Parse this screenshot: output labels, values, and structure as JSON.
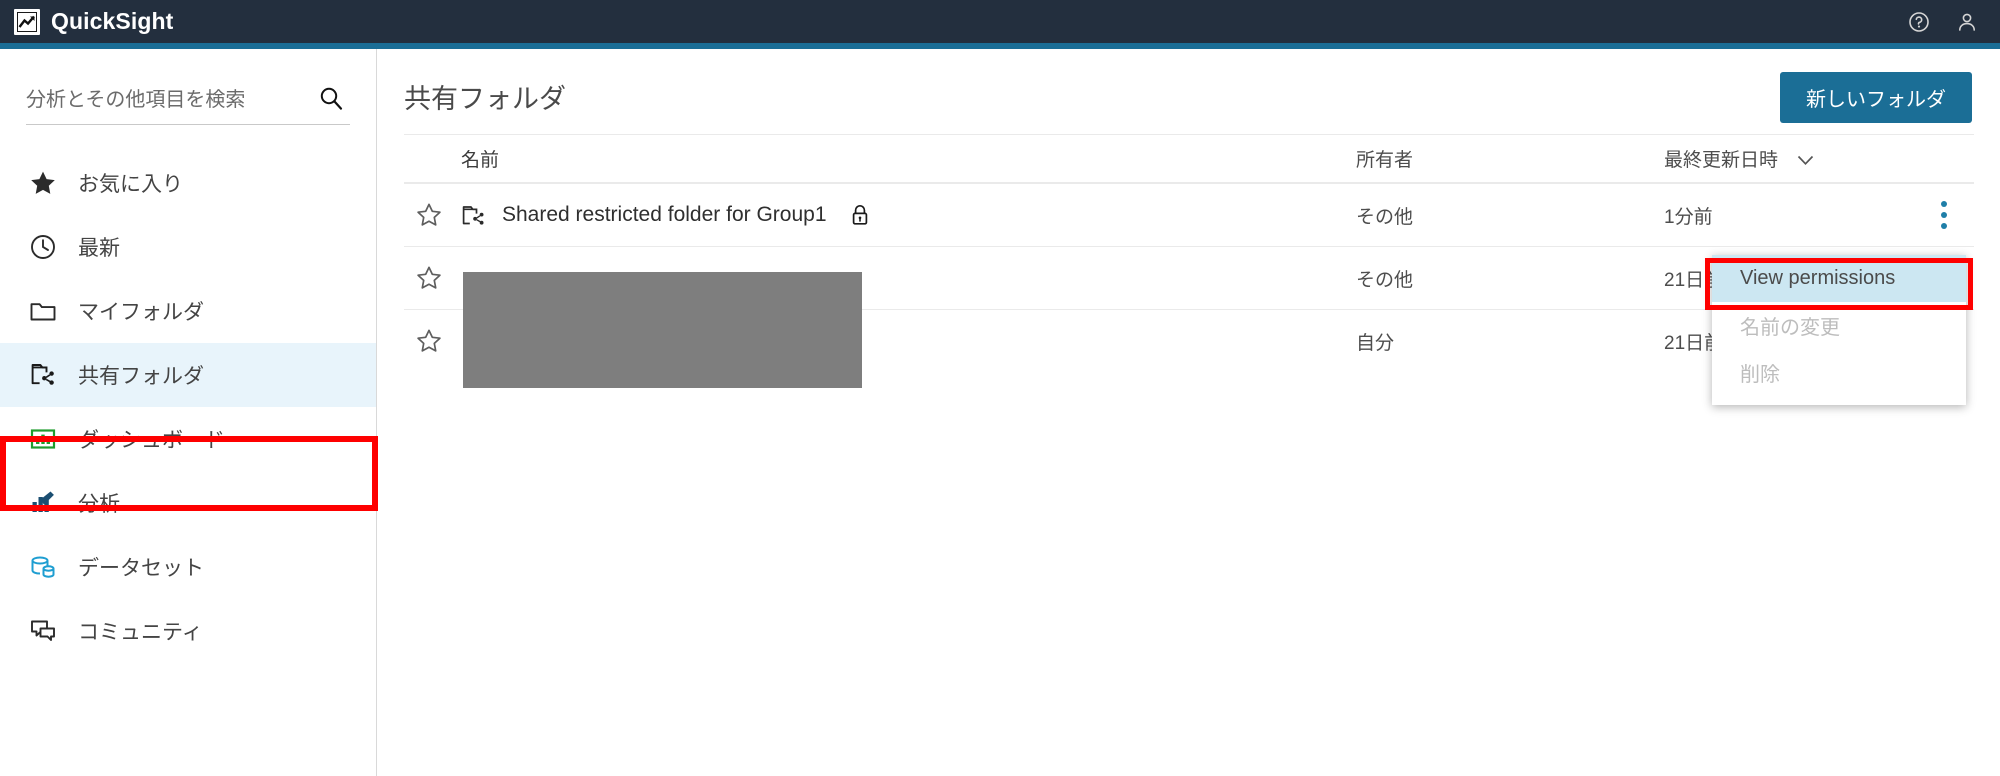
{
  "app": {
    "name": "QuickSight",
    "logo_icon": "quicksight-logo-icon",
    "help_icon": "help-circle-icon",
    "account_icon": "user-account-icon",
    "accent_color": "#1b6e96",
    "topbar_color": "#232f3e"
  },
  "sidebar": {
    "search": {
      "placeholder": "分析とその他項目を検索",
      "value": "",
      "icon": "search-icon"
    },
    "items": [
      {
        "label": "お気に入り",
        "icon": "star-filled-icon",
        "selected": false
      },
      {
        "label": "最新",
        "icon": "clock-icon",
        "selected": false
      },
      {
        "label": "マイフォルダ",
        "icon": "folder-icon",
        "selected": false
      },
      {
        "label": "共有フォルダ",
        "icon": "shared-folder-icon",
        "selected": true
      },
      {
        "label": "ダッシュボード",
        "icon": "dashboard-icon",
        "selected": false
      },
      {
        "label": "分析",
        "icon": "analysis-icon",
        "selected": false
      },
      {
        "label": "データセット",
        "icon": "dataset-icon",
        "selected": false
      },
      {
        "label": "コミュニティ",
        "icon": "community-icon",
        "selected": false
      }
    ],
    "highlight_color": "#fe0000"
  },
  "main": {
    "title": "共有フォルダ",
    "new_folder_button": "新しいフォルダ",
    "table": {
      "columns": {
        "name": "名前",
        "owner": "所有者",
        "updated": "最終更新日時",
        "sort_caret": "chevron-down-icon"
      },
      "rows": [
        {
          "name": "Shared restricted folder for Group1",
          "owner": "その他",
          "updated": "1分前",
          "restricted": true,
          "favorited": false,
          "redacted": false
        },
        {
          "name": "",
          "owner": "その他",
          "updated": "21日前",
          "restricted": false,
          "favorited": false,
          "redacted": true
        },
        {
          "name": "",
          "owner": "自分",
          "updated": "21日前",
          "restricted": false,
          "favorited": false,
          "redacted": true
        }
      ]
    }
  },
  "context_menu": {
    "items": [
      {
        "label": "View permissions",
        "state": "highlighted"
      },
      {
        "label": "名前の変更",
        "state": "disabled"
      },
      {
        "label": "削除",
        "state": "disabled"
      }
    ],
    "highlight_color": "#fe0000",
    "active_bg": "#cce7f2"
  }
}
